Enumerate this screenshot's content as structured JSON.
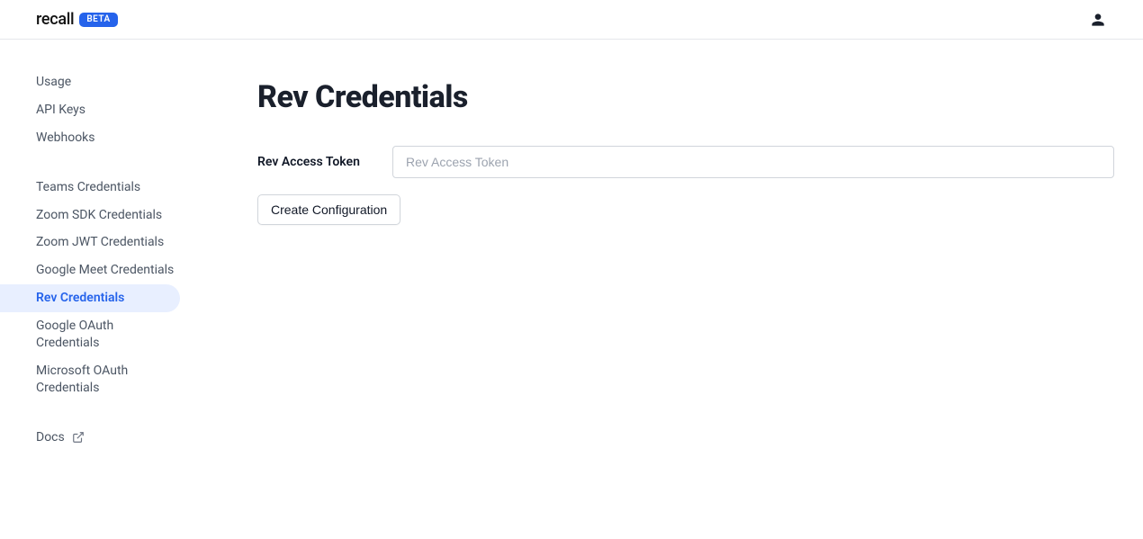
{
  "header": {
    "logo_text": "recall",
    "badge": "BETA"
  },
  "sidebar": {
    "group1": [
      {
        "label": "Usage"
      },
      {
        "label": "API Keys"
      },
      {
        "label": "Webhooks"
      }
    ],
    "group2": [
      {
        "label": "Teams Credentials"
      },
      {
        "label": "Zoom SDK Credentials"
      },
      {
        "label": "Zoom JWT Credentials"
      },
      {
        "label": "Google Meet Credentials"
      },
      {
        "label": "Rev Credentials",
        "active": true
      },
      {
        "label": "Google OAuth Credentials"
      },
      {
        "label": "Microsoft OAuth Credentials"
      }
    ],
    "docs_label": "Docs"
  },
  "main": {
    "title": "Rev Credentials",
    "access_token_label": "Rev Access Token",
    "access_token_placeholder": "Rev Access Token",
    "access_token_value": "",
    "create_button_label": "Create Configuration"
  }
}
